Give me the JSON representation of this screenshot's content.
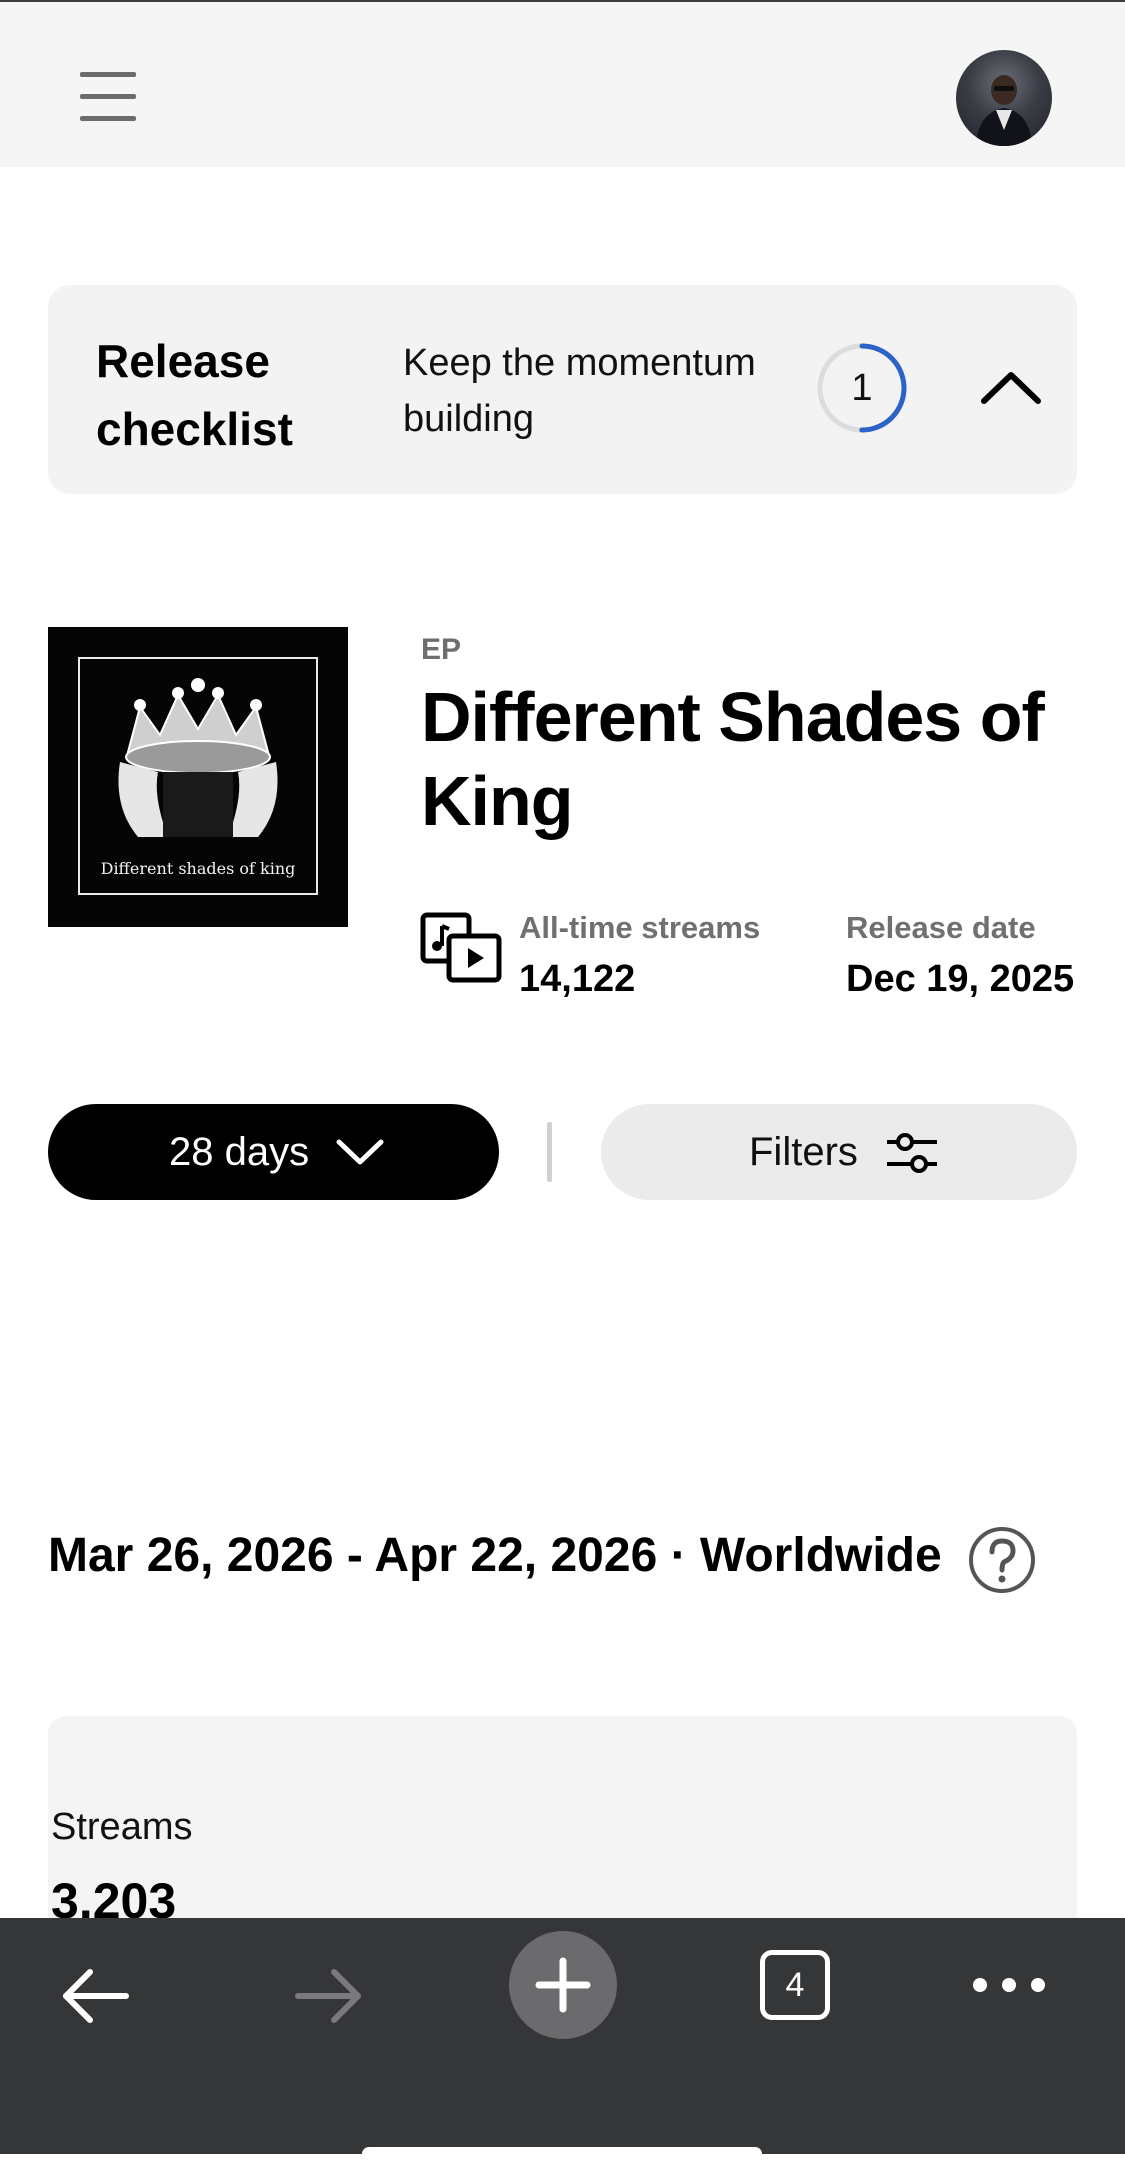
{
  "header": {
    "menu_icon": "hamburger-icon",
    "avatar_icon": "profile-avatar"
  },
  "checklist": {
    "title": "Release checklist",
    "subtitle": "Keep the momentum building",
    "progress_count": "1",
    "progress_fraction": 0.5,
    "progress_color": "#2b63c8",
    "toggle_icon": "chevron-up-icon"
  },
  "release": {
    "type": "EP",
    "title": "Different Shades of King",
    "cover_caption": "Different shades of king",
    "streams_label": "All-time streams",
    "streams_value": "14,122",
    "date_label": "Release date",
    "date_value": "Dec 19, 2025"
  },
  "controls": {
    "range_label": "28 days",
    "filters_label": "Filters"
  },
  "period": {
    "range": "Mar 26, 2026 - Apr 22, 2026 · Worldwide"
  },
  "stats": {
    "streams_label": "Streams",
    "streams_value": "3,203"
  },
  "browser": {
    "tab_count": "4",
    "icons": [
      "back-arrow-icon",
      "forward-arrow-icon",
      "new-tab-plus-icon",
      "tabs-icon",
      "more-icon"
    ]
  },
  "colors": {
    "accent": "#2b63c8",
    "browser_bar": "#353638"
  }
}
